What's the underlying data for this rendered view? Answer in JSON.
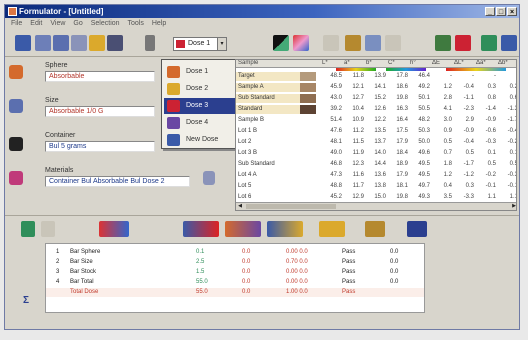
{
  "window": {
    "title": "Formulator - [Untitled]",
    "controls": [
      "_",
      "□",
      "×"
    ]
  },
  "menu": [
    "File",
    "Edit",
    "View",
    "Go",
    "Selection",
    "Tools",
    "Help"
  ],
  "toolbar": {
    "combo_value": "Dose 1",
    "combo_arrow": "▾"
  },
  "form": {
    "label_1": "Sphere",
    "field_1": "Absorbable",
    "label_2": "Size",
    "field_2": "Absorbable 1/0 G",
    "label_3": "Container",
    "field_3": "Bul 5 grams",
    "label_4": "Materials",
    "field_4": "Container Bul Absorbable Bul Dose 2"
  },
  "popup": {
    "items": [
      "Dose 1",
      "Dose 2",
      "Dose 3",
      "Dose 4",
      "New Dose"
    ],
    "selected_index": 2
  },
  "grid": {
    "header": [
      "Sample",
      "L*",
      "a*",
      "b*",
      "C*",
      "h°",
      "ΔE",
      "ΔL*",
      "Δa*",
      "Δb*"
    ],
    "rows": [
      {
        "label": "Target",
        "swatch": "#b49a7c",
        "cells": [
          "48.5",
          "11.8",
          "13.9",
          "17.8",
          "46.4",
          "-",
          "-",
          "-",
          "-"
        ]
      },
      {
        "label": "Sample A",
        "swatch": "#a78666",
        "cells": [
          "45.9",
          "12.1",
          "14.1",
          "18.6",
          "49.2",
          "1.2",
          "-0.4",
          "0.3",
          "0.2"
        ]
      },
      {
        "label": "Sub Standard",
        "swatch": "#8f6e51",
        "cells": [
          "43.0",
          "12.7",
          "15.2",
          "19.8",
          "50.1",
          "2.8",
          "-1.1",
          "0.8",
          "0.6"
        ]
      },
      {
        "label": "Standard",
        "swatch": "#5d4333",
        "cells": [
          "39.2",
          "10.4",
          "12.6",
          "16.3",
          "50.5",
          "4.1",
          "-2.3",
          "-1.4",
          "-1.3"
        ]
      },
      {
        "label": "Sample B",
        "swatch": "#ffffff",
        "cells": [
          "51.4",
          "10.9",
          "12.2",
          "16.4",
          "48.2",
          "3.0",
          "2.9",
          "-0.9",
          "-1.7"
        ]
      },
      {
        "label": "Lot 1 B",
        "swatch": "#ffffff",
        "cells": [
          "47.6",
          "11.2",
          "13.5",
          "17.5",
          "50.3",
          "0.9",
          "-0.9",
          "-0.6",
          "-0.4"
        ]
      },
      {
        "label": "Lot 2",
        "swatch": "#ffffff",
        "cells": [
          "48.1",
          "11.5",
          "13.7",
          "17.9",
          "50.0",
          "0.5",
          "-0.4",
          "-0.3",
          "-0.2"
        ]
      },
      {
        "label": "Lot 3 B",
        "swatch": "#ffffff",
        "cells": [
          "49.0",
          "11.9",
          "14.0",
          "18.4",
          "49.6",
          "0.7",
          "0.5",
          "0.1",
          "0.1"
        ]
      },
      {
        "label": "Sub Standard",
        "swatch": "#ffffff",
        "cells": [
          "46.8",
          "12.3",
          "14.4",
          "18.9",
          "49.5",
          "1.8",
          "-1.7",
          "0.5",
          "0.5"
        ]
      },
      {
        "label": "Lot 4 A",
        "swatch": "#ffffff",
        "cells": [
          "47.3",
          "11.6",
          "13.6",
          "17.9",
          "49.5",
          "1.2",
          "-1.2",
          "-0.2",
          "-0.3"
        ]
      },
      {
        "label": "Lot 5",
        "swatch": "#ffffff",
        "cells": [
          "48.8",
          "11.7",
          "13.8",
          "18.1",
          "49.7",
          "0.4",
          "0.3",
          "-0.1",
          "-0.1"
        ]
      },
      {
        "label": "Lot 6",
        "swatch": "#ffffff",
        "cells": [
          "45.2",
          "12.9",
          "15.0",
          "19.8",
          "49.3",
          "3.5",
          "-3.3",
          "1.1",
          "1.1"
        ]
      }
    ]
  },
  "bottom": {
    "rows": [
      {
        "idx": "1",
        "name": "Bar Sphere",
        "a": "0.1",
        "b": "0.0",
        "c": "0.00 0.0",
        "d": "Pass",
        "e": "0.0"
      },
      {
        "idx": "2",
        "name": "Bar Size",
        "a": "2.5",
        "b": "0.0",
        "c": "0.70 0.0",
        "d": "Pass",
        "e": "0.0"
      },
      {
        "idx": "3",
        "name": "Bar Stock",
        "a": "1.5",
        "b": "0.0",
        "c": "0.00 0.0",
        "d": "Pass",
        "e": "0.0"
      },
      {
        "idx": "4",
        "name": "Bar Total",
        "a": "55.0",
        "b": "0.0",
        "c": "0.00 0.0",
        "d": "Pass",
        "e": "0.0"
      }
    ],
    "total": {
      "idx": "",
      "name": "Total Dose",
      "a": "55.0",
      "b": "0.0",
      "c": "1.00 0.0",
      "d": "Pass",
      "e": ""
    }
  },
  "colors": {
    "accent": "#2b3f8f",
    "title_start": "#0b2a7c",
    "title_end": "#9fb7e6",
    "red_text": "#b3362b"
  },
  "icons": [
    "flask-icon",
    "save-icon",
    "open-icon",
    "print-icon",
    "chart-icon",
    "palette-icon",
    "spectrum-icon",
    "grid-icon",
    "search-icon"
  ]
}
